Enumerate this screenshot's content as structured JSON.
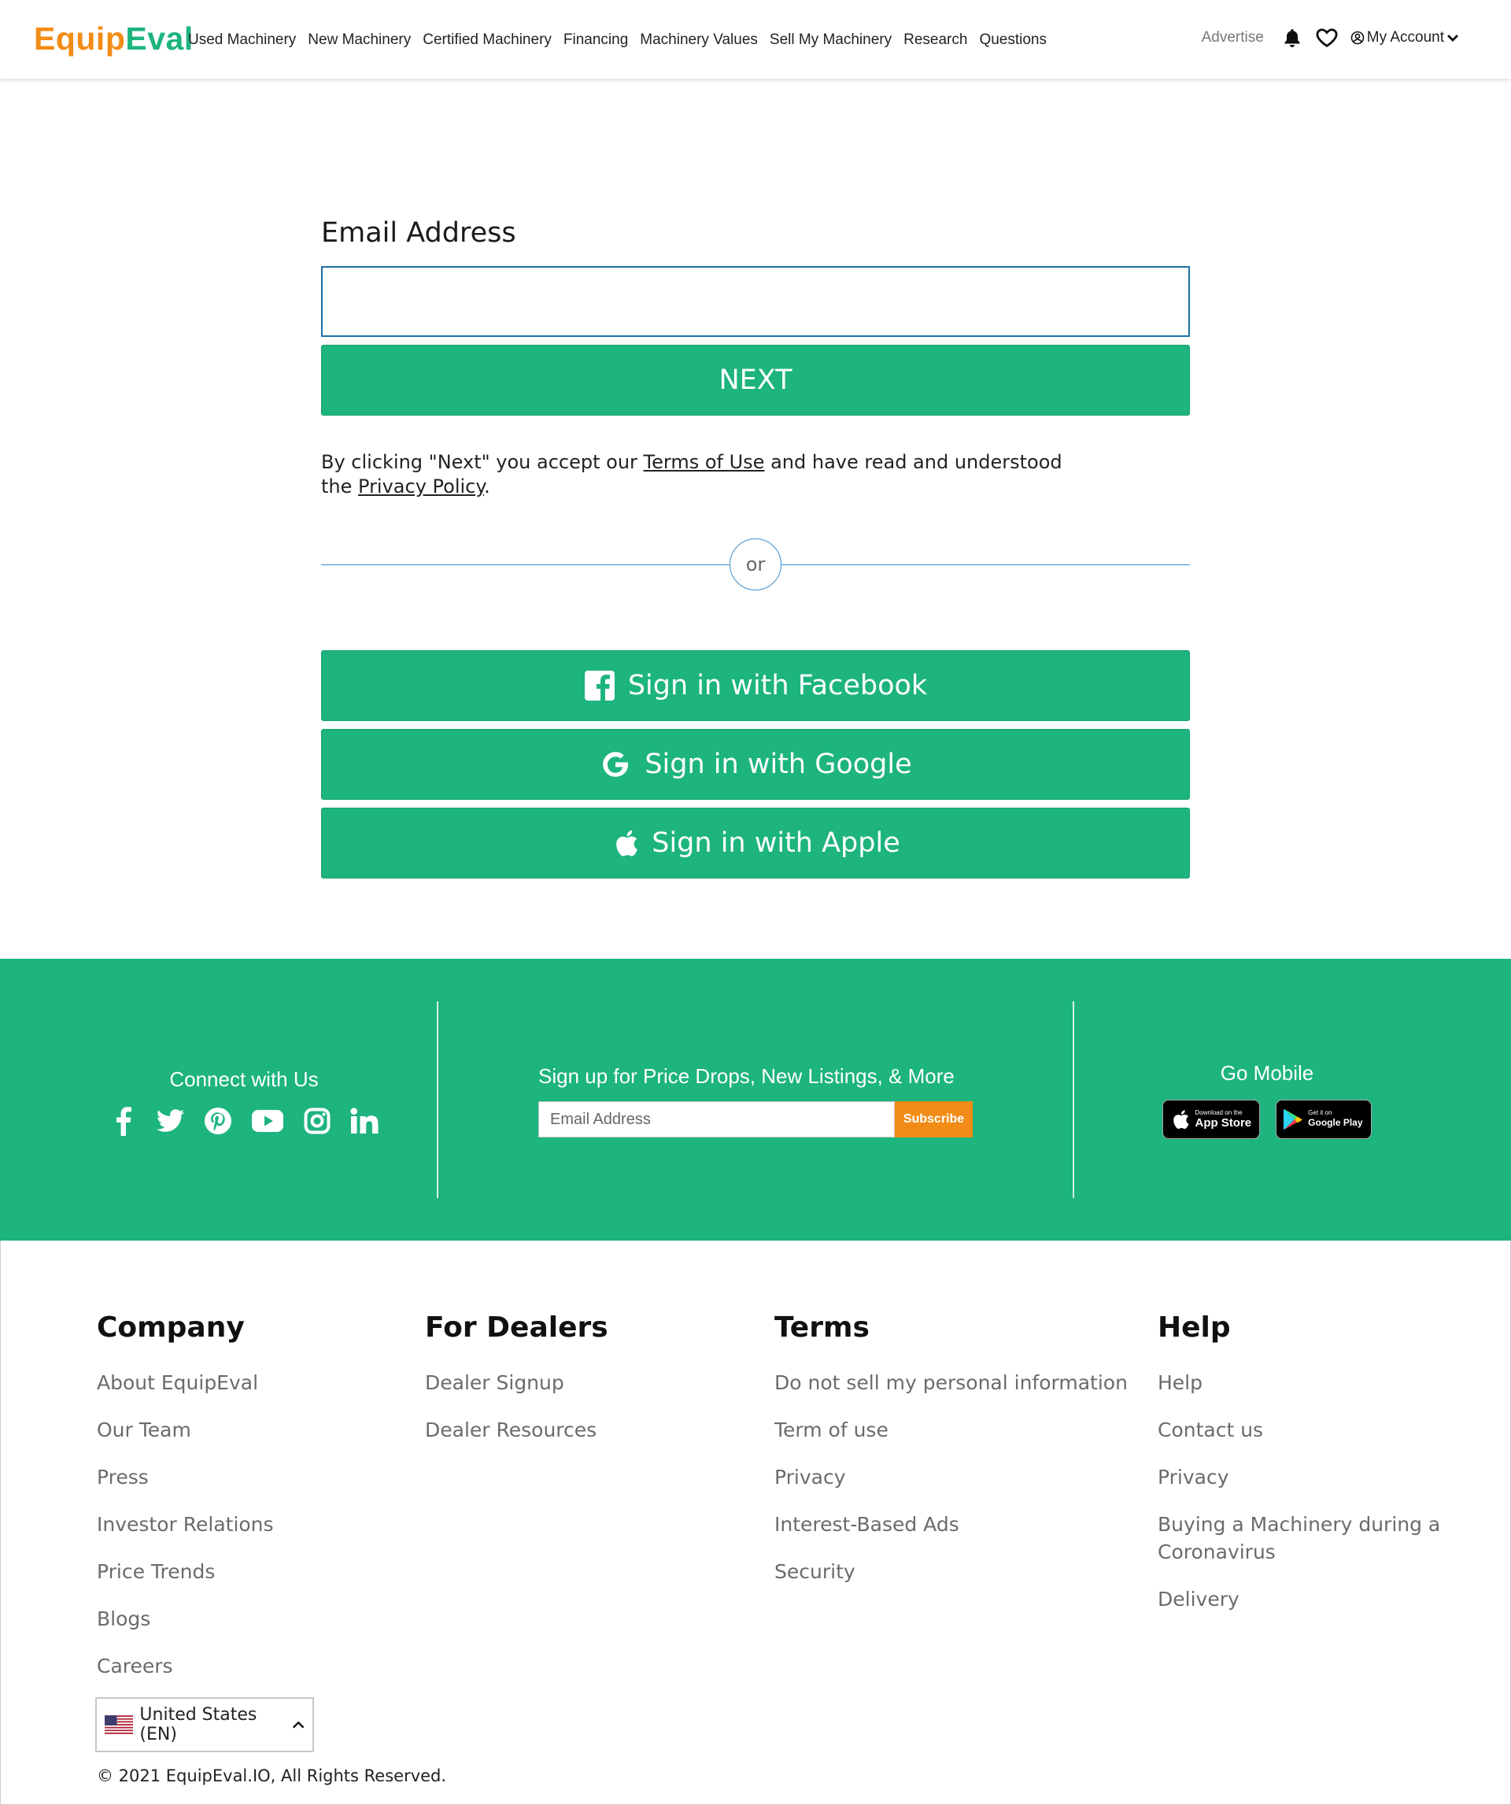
{
  "header": {
    "logo_part1": "Equip",
    "logo_part2": "Eval",
    "nav": [
      "Used Machinery",
      "New Machinery",
      "Certified Machinery",
      "Financing",
      "Machinery Values",
      "Sell My Machinery",
      "Research",
      "Questions"
    ],
    "advertise": "Advertise",
    "account": "My Account",
    "icons": [
      "bell-icon",
      "heart-icon",
      "user-circle-icon",
      "chevron-down-icon"
    ]
  },
  "login": {
    "email_label": "Email Address",
    "email_value": "",
    "next_label": "NEXT",
    "legal_prefix": "By clicking \"Next\" you accept our ",
    "terms_link": "Terms of Use",
    "legal_mid": " and have read and understood",
    "legal_line2_prefix": " the ",
    "privacy_link": "Privacy Policy",
    "legal_suffix": ".",
    "or_text": "or",
    "facebook_label": "Sign in with Facebook",
    "google_label": "Sign in with Google",
    "apple_label": "Sign in with Apple"
  },
  "band": {
    "connect_title": "Connect with Us",
    "social_icons": [
      "facebook-icon",
      "twitter-icon",
      "pinterest-icon",
      "youtube-icon",
      "instagram-icon",
      "linkedin-icon"
    ],
    "signup_title": "Sign up for Price Drops, New Listings, & More",
    "signup_placeholder": "Email Address",
    "subscribe_label": "Subscribe",
    "mobile_title": "Go Mobile",
    "app_store_small": "Download on the",
    "app_store_big": "App Store",
    "google_play_small": "Get it on",
    "google_play_big": "Google Play"
  },
  "footer": {
    "company_title": "Company",
    "company_links": [
      "About EquipEval",
      "Our Team",
      "Press",
      "Investor Relations",
      "Price Trends",
      "Blogs",
      "Careers"
    ],
    "dealers_title": "For Dealers",
    "dealers_links": [
      "Dealer Signup",
      "Dealer Resources"
    ],
    "terms_title": "Terms",
    "terms_links": [
      "Do not sell my personal information",
      "Term of use",
      "Privacy",
      "Interest-Based Ads",
      "Security"
    ],
    "help_title": "Help",
    "help_links": [
      "Help",
      "Contact us",
      "Privacy",
      "Buying a Machinery during a Coronavirus",
      "Delivery"
    ],
    "locale": "United States (EN)",
    "copyright": "© 2021 EquipEval.IO, All Rights Reserved."
  },
  "colors": {
    "brand_green": "#1db47d",
    "brand_orange": "#f28c16",
    "input_border": "#1a6fa6"
  }
}
